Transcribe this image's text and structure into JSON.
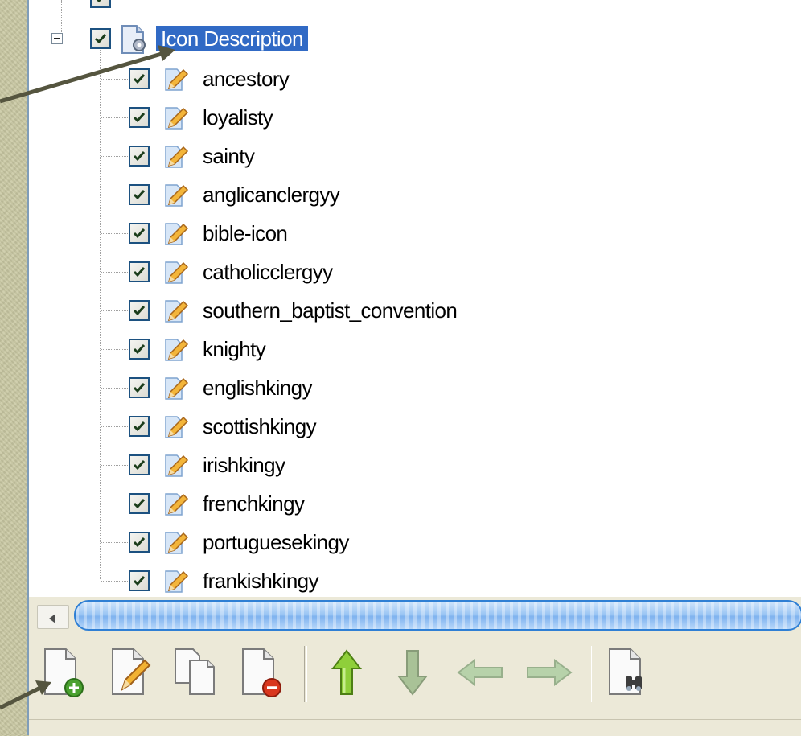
{
  "tree": {
    "partial_node": {
      "label": ""
    },
    "parent": {
      "label": "Icon Description",
      "checked": true,
      "expanded": true
    },
    "children": [
      {
        "label": "ancestory",
        "checked": true
      },
      {
        "label": "loyalisty",
        "checked": true
      },
      {
        "label": "sainty",
        "checked": true
      },
      {
        "label": "anglicanclergyy",
        "checked": true
      },
      {
        "label": "bible-icon",
        "checked": true
      },
      {
        "label": "catholicclergyy",
        "checked": true
      },
      {
        "label": "southern_baptist_convention",
        "checked": true
      },
      {
        "label": "knighty",
        "checked": true
      },
      {
        "label": "englishkingy",
        "checked": true
      },
      {
        "label": "scottishkingy",
        "checked": true
      },
      {
        "label": "irishkingy",
        "checked": true
      },
      {
        "label": "frenchkingy",
        "checked": true
      },
      {
        "label": "portuguesekingy",
        "checked": true
      },
      {
        "label": "frankishkingy",
        "checked": true
      }
    ]
  },
  "toolbar": {
    "buttons": [
      {
        "icon": "new-document-icon",
        "enabled": true
      },
      {
        "icon": "edit-document-icon",
        "enabled": true
      },
      {
        "icon": "copy-document-icon",
        "enabled": true
      },
      {
        "icon": "delete-document-icon",
        "enabled": true
      },
      {
        "icon": "move-up-icon",
        "enabled": true
      },
      {
        "icon": "move-down-icon",
        "enabled": false
      },
      {
        "icon": "move-left-icon",
        "enabled": false
      },
      {
        "icon": "move-right-icon",
        "enabled": false
      },
      {
        "icon": "find-document-icon",
        "enabled": true
      }
    ]
  },
  "colors": {
    "selection": "#316ac5",
    "backdrop": "#c9c8a2",
    "arrow": "#55553f",
    "scroll_thumb": "#7fb3ef"
  }
}
